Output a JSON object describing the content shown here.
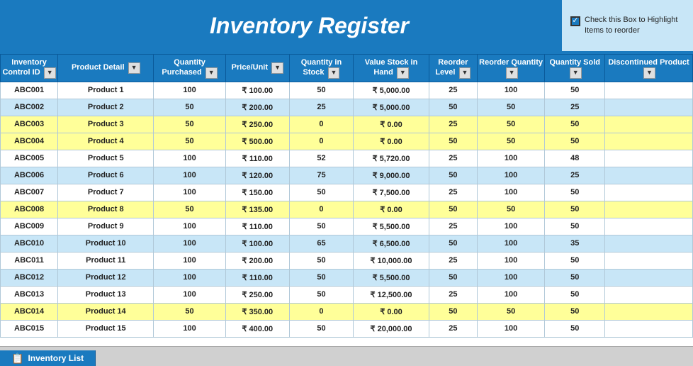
{
  "header": {
    "title": "Inventory Register",
    "checkbox_label": "Check this Box to Highlight Items to reorder"
  },
  "columns": [
    {
      "id": "control_id",
      "label": "Inventory Control ID"
    },
    {
      "id": "product_detail",
      "label": "Product Detail"
    },
    {
      "id": "qty_purchased",
      "label": "Quantity Purchased"
    },
    {
      "id": "price_unit",
      "label": "Price/Unit"
    },
    {
      "id": "qty_stock",
      "label": "Quantity in Stock"
    },
    {
      "id": "value_stock",
      "label": "Value Stock in Hand"
    },
    {
      "id": "reorder_level",
      "label": "Reorder Level"
    },
    {
      "id": "reorder_qty",
      "label": "Reorder Quantity"
    },
    {
      "id": "qty_sold",
      "label": "Quantity Sold"
    },
    {
      "id": "discontinued",
      "label": "Discontinued Product"
    }
  ],
  "rows": [
    {
      "control_id": "ABC001",
      "product_detail": "Product 1",
      "qty_purchased": "100",
      "price_unit": "₹ 100.00",
      "qty_stock": "50",
      "value_stock": "₹ 5,000.00",
      "reorder_level": "25",
      "reorder_qty": "100",
      "qty_sold": "50",
      "discontinued": ""
    },
    {
      "control_id": "ABC002",
      "product_detail": "Product 2",
      "qty_purchased": "50",
      "price_unit": "₹ 200.00",
      "qty_stock": "25",
      "value_stock": "₹ 5,000.00",
      "reorder_level": "50",
      "reorder_qty": "50",
      "qty_sold": "25",
      "discontinued": ""
    },
    {
      "control_id": "ABC003",
      "product_detail": "Product 3",
      "qty_purchased": "50",
      "price_unit": "₹ 250.00",
      "qty_stock": "0",
      "value_stock": "₹ 0.00",
      "reorder_level": "25",
      "reorder_qty": "50",
      "qty_sold": "50",
      "discontinued": ""
    },
    {
      "control_id": "ABC004",
      "product_detail": "Product 4",
      "qty_purchased": "50",
      "price_unit": "₹ 500.00",
      "qty_stock": "0",
      "value_stock": "₹ 0.00",
      "reorder_level": "50",
      "reorder_qty": "50",
      "qty_sold": "50",
      "discontinued": ""
    },
    {
      "control_id": "ABC005",
      "product_detail": "Product 5",
      "qty_purchased": "100",
      "price_unit": "₹ 110.00",
      "qty_stock": "52",
      "value_stock": "₹ 5,720.00",
      "reorder_level": "25",
      "reorder_qty": "100",
      "qty_sold": "48",
      "discontinued": ""
    },
    {
      "control_id": "ABC006",
      "product_detail": "Product 6",
      "qty_purchased": "100",
      "price_unit": "₹ 120.00",
      "qty_stock": "75",
      "value_stock": "₹ 9,000.00",
      "reorder_level": "50",
      "reorder_qty": "100",
      "qty_sold": "25",
      "discontinued": ""
    },
    {
      "control_id": "ABC007",
      "product_detail": "Product 7",
      "qty_purchased": "100",
      "price_unit": "₹ 150.00",
      "qty_stock": "50",
      "value_stock": "₹ 7,500.00",
      "reorder_level": "25",
      "reorder_qty": "100",
      "qty_sold": "50",
      "discontinued": ""
    },
    {
      "control_id": "ABC008",
      "product_detail": "Product 8",
      "qty_purchased": "50",
      "price_unit": "₹ 135.00",
      "qty_stock": "0",
      "value_stock": "₹ 0.00",
      "reorder_level": "50",
      "reorder_qty": "50",
      "qty_sold": "50",
      "discontinued": ""
    },
    {
      "control_id": "ABC009",
      "product_detail": "Product 9",
      "qty_purchased": "100",
      "price_unit": "₹ 110.00",
      "qty_stock": "50",
      "value_stock": "₹ 5,500.00",
      "reorder_level": "25",
      "reorder_qty": "100",
      "qty_sold": "50",
      "discontinued": ""
    },
    {
      "control_id": "ABC010",
      "product_detail": "Product 10",
      "qty_purchased": "100",
      "price_unit": "₹ 100.00",
      "qty_stock": "65",
      "value_stock": "₹ 6,500.00",
      "reorder_level": "50",
      "reorder_qty": "100",
      "qty_sold": "35",
      "discontinued": ""
    },
    {
      "control_id": "ABC011",
      "product_detail": "Product 11",
      "qty_purchased": "100",
      "price_unit": "₹ 200.00",
      "qty_stock": "50",
      "value_stock": "₹ 10,000.00",
      "reorder_level": "25",
      "reorder_qty": "100",
      "qty_sold": "50",
      "discontinued": ""
    },
    {
      "control_id": "ABC012",
      "product_detail": "Product 12",
      "qty_purchased": "100",
      "price_unit": "₹ 110.00",
      "qty_stock": "50",
      "value_stock": "₹ 5,500.00",
      "reorder_level": "50",
      "reorder_qty": "100",
      "qty_sold": "50",
      "discontinued": ""
    },
    {
      "control_id": "ABC013",
      "product_detail": "Product 13",
      "qty_purchased": "100",
      "price_unit": "₹ 250.00",
      "qty_stock": "50",
      "value_stock": "₹ 12,500.00",
      "reorder_level": "25",
      "reorder_qty": "100",
      "qty_sold": "50",
      "discontinued": ""
    },
    {
      "control_id": "ABC014",
      "product_detail": "Product 14",
      "qty_purchased": "50",
      "price_unit": "₹ 350.00",
      "qty_stock": "0",
      "value_stock": "₹ 0.00",
      "reorder_level": "50",
      "reorder_qty": "50",
      "qty_sold": "50",
      "discontinued": ""
    },
    {
      "control_id": "ABC015",
      "product_detail": "Product 15",
      "qty_purchased": "100",
      "price_unit": "₹ 400.00",
      "qty_stock": "50",
      "value_stock": "₹ 20,000.00",
      "reorder_level": "25",
      "reorder_qty": "100",
      "qty_sold": "50",
      "discontinued": ""
    }
  ],
  "tab": {
    "label": "Inventory List"
  }
}
